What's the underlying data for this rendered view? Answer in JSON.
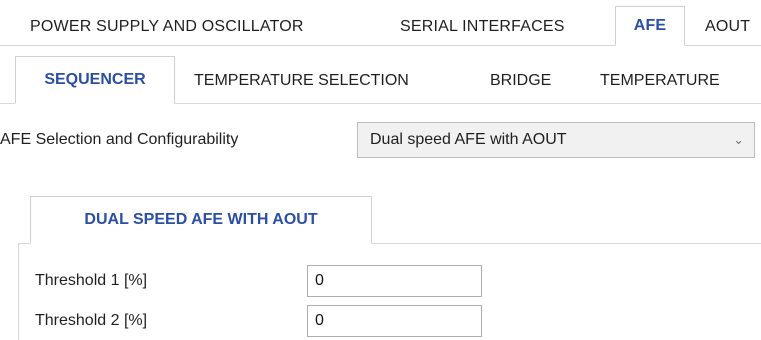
{
  "main_tabs": [
    {
      "label": "POWER SUPPLY AND OSCILLATOR",
      "active": false
    },
    {
      "label": "SERIAL INTERFACES",
      "active": false
    },
    {
      "label": "AFE",
      "active": true
    },
    {
      "label": "AOUT",
      "active": false
    }
  ],
  "afe_tabs": [
    {
      "label": "SEQUENCER",
      "active": true
    },
    {
      "label": "TEMPERATURE SELECTION",
      "active": false
    },
    {
      "label": "BRIDGE",
      "active": false
    },
    {
      "label": "TEMPERATURE",
      "active": false
    }
  ],
  "afe_config": {
    "label": "AFE Selection and Configurability",
    "selected": "Dual speed AFE with AOUT"
  },
  "sub_tab": {
    "label": "DUAL SPEED AFE WITH AOUT"
  },
  "fields": [
    {
      "label": "Threshold 1 [%]",
      "value": "0"
    },
    {
      "label": "Threshold 2 [%]",
      "value": "0"
    }
  ],
  "colors": {
    "accent": "#2a4fa3",
    "border": "#cfcfcf"
  },
  "icons": {
    "dropdown": "chevron-down-icon"
  }
}
